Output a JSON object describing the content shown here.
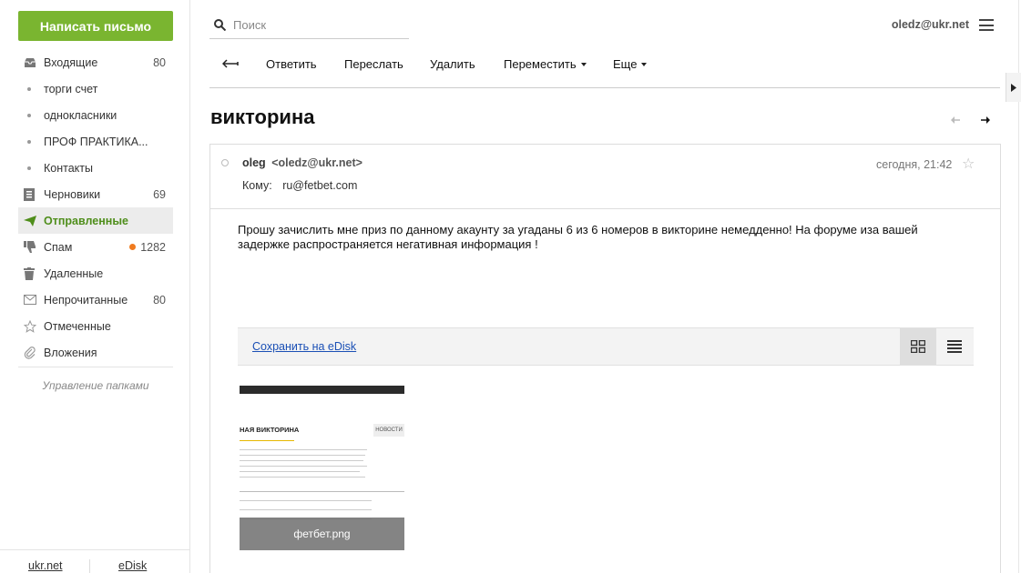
{
  "sidebar": {
    "compose_label": "Написать письмо",
    "folders": [
      {
        "label": "Входящие",
        "count": "80"
      },
      {
        "label": "торги счет"
      },
      {
        "label": "однокласники"
      },
      {
        "label": "ПРОФ ПРАКТИКА..."
      },
      {
        "label": "Контакты"
      },
      {
        "label": "Черновики",
        "count": "69"
      },
      {
        "label": "Отправленные"
      },
      {
        "label": "Спам",
        "count": "1282"
      },
      {
        "label": "Удаленные"
      },
      {
        "label": "Непрочитанные",
        "count": "80"
      },
      {
        "label": "Отмеченные"
      },
      {
        "label": "Вложения"
      }
    ],
    "manage_label": "Управление папками",
    "footer": {
      "ukr": "ukr.net",
      "edisk": "eDisk"
    }
  },
  "header": {
    "search_placeholder": "Поиск",
    "user": "oledz@ukr.net"
  },
  "toolbar": {
    "reply": "Ответить",
    "forward": "Переслать",
    "delete": "Удалить",
    "move": "Переместить",
    "more": "Еще"
  },
  "message": {
    "subject": "викторина",
    "sender_name": "oleg",
    "sender_email": "<oledz@ukr.net>",
    "date": "сегодня, 21:42",
    "to_label": "Кому:",
    "to_address": "ru@fetbet.com",
    "body": "Прошу зачислить мне приз по данному акаунту за  угаданы 6  из 6  номеров в викторине немедденно! На  форуме  иза вашей задержке  распространяется  негативная  информация !",
    "save_edisk": "Сохранить на eDisk",
    "attachment": {
      "filename": "фетбет.png",
      "preview_title": "НАЯ ВИКТОРИНА",
      "preview_news": "НОВОСТИ"
    }
  },
  "colors": {
    "accent_green": "#7ab530",
    "active_text": "#4f8e1b",
    "spam_dot": "#f07b1f",
    "link": "#1a4fb5"
  }
}
